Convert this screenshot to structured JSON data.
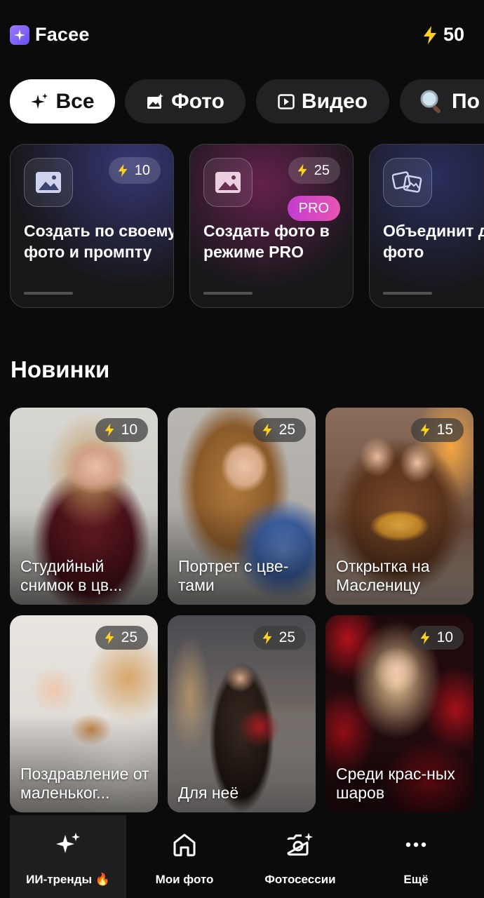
{
  "app": {
    "name": "Facee",
    "balance": "50"
  },
  "filters": [
    {
      "label": "Все",
      "active": true
    },
    {
      "label": "Фото"
    },
    {
      "label": "Видео"
    },
    {
      "label": "По"
    }
  ],
  "tools": [
    {
      "title": "Создать по своему фото и промпту",
      "cost": "10"
    },
    {
      "title": "Создать фото в режиме PRO",
      "cost": "25",
      "badge": "PRO"
    },
    {
      "title": "Объединит два фото",
      "cost": ""
    }
  ],
  "section": {
    "title": "Новинки"
  },
  "items": [
    {
      "title": "Студийный снимок в цв...",
      "cost": "10"
    },
    {
      "title": "Портрет с цве-тами",
      "cost": "25"
    },
    {
      "title": "Открытка на Масленицу",
      "cost": "15"
    },
    {
      "title": "Поздравление от маленьког...",
      "cost": "25"
    },
    {
      "title": "Для неё",
      "cost": "25"
    },
    {
      "title": "Среди крас-ных шаров",
      "cost": "10"
    }
  ],
  "nav": [
    {
      "label": "ИИ-тренды 🔥",
      "active": true,
      "icon": "sparkles-icon"
    },
    {
      "label": "Мои фото",
      "icon": "home-icon"
    },
    {
      "label": "Фотосессии",
      "icon": "camera-sparkle-icon"
    },
    {
      "label": "Ещё",
      "icon": "more-icon"
    }
  ],
  "colors": {
    "accent_bolt": "#ffd21f",
    "pro_badge": "#d846c4",
    "background": "#0b0b0c"
  }
}
